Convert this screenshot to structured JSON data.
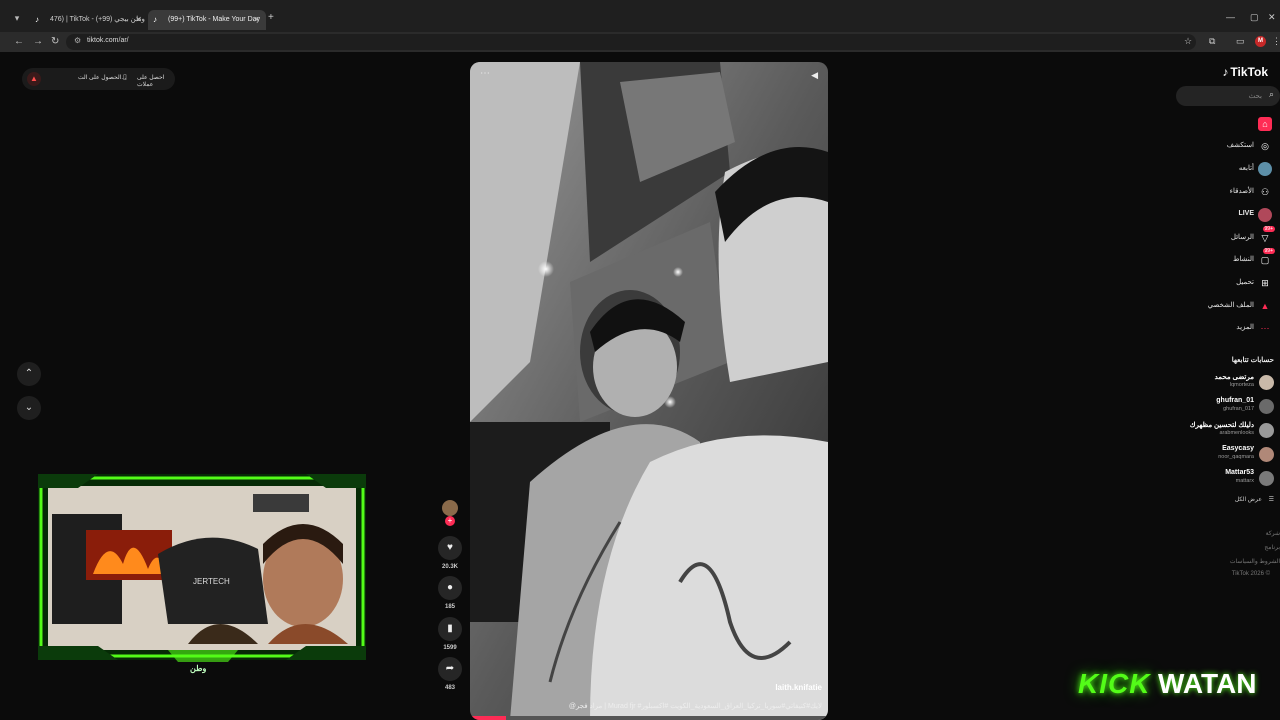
{
  "browser": {
    "tabs": [
      {
        "title": "476) | TikTok - وطن بيجي (99+)",
        "active": false
      },
      {
        "title": "(99+) TikTok - Make Your Day",
        "active": true
      }
    ],
    "address": "tiktok.com/ar/",
    "profile_initial": "M"
  },
  "banner": {
    "item1": "احصل على عملات",
    "item2": "الحصول على الت..."
  },
  "video": {
    "author": "laith.knifatie",
    "caption": "@مراد فجر | Murad fjr #لايك#كنيفاتي#سوريا_تركيا_العراق_السعودية_الكويت #اكسبلور",
    "progress_fraction": 0.1
  },
  "actions": {
    "likes": "20.3K",
    "comments": "185",
    "saves": "1599",
    "shares": "483"
  },
  "sidebar": {
    "logo": "TikTok",
    "search_placeholder": "بحث",
    "items": [
      {
        "label": "",
        "icon": "home-icon"
      },
      {
        "label": "استكشف",
        "icon": "compass-icon"
      },
      {
        "label": "أتابعه",
        "icon": "avatar-icon"
      },
      {
        "label": "الأصدقاء",
        "icon": "friends-icon"
      },
      {
        "label": "LIVE",
        "icon": "live-icon"
      },
      {
        "label": "الرسائل",
        "icon": "messages-icon",
        "badge": "99+"
      },
      {
        "label": "النشاط",
        "icon": "activity-icon",
        "badge": "99+"
      },
      {
        "label": "تحميل",
        "icon": "upload-icon"
      },
      {
        "label": "الملف الشخصي",
        "icon": "profile-icon"
      },
      {
        "label": "المزيد",
        "icon": "more-icon"
      }
    ],
    "following_title": "حسابات تتابعها",
    "accounts": [
      {
        "name": "مرتضى محمد",
        "handle": "lqmorteza"
      },
      {
        "name": "ghufran_01",
        "handle": "ghufran_017"
      },
      {
        "name": "دليلك لتحسين مظهرك",
        "handle": "arabmenlooks"
      },
      {
        "name": "Easycasy",
        "handle": "noor_qaqmara"
      },
      {
        "name": "Mattar53",
        "handle": "mattarx"
      }
    ],
    "see_all": "عرض الكل",
    "footer": [
      "شركة",
      "برنامج",
      "الشروط والسياسات",
      "TikTok 2026 ©"
    ]
  },
  "stream": {
    "cam_name": "وطن",
    "chair_brand": "JERTECH",
    "overlay_kick": "KICK",
    "overlay_watan": "WATAN"
  },
  "colors": {
    "accent": "#fe2c55",
    "kick_green": "#53fc18"
  }
}
